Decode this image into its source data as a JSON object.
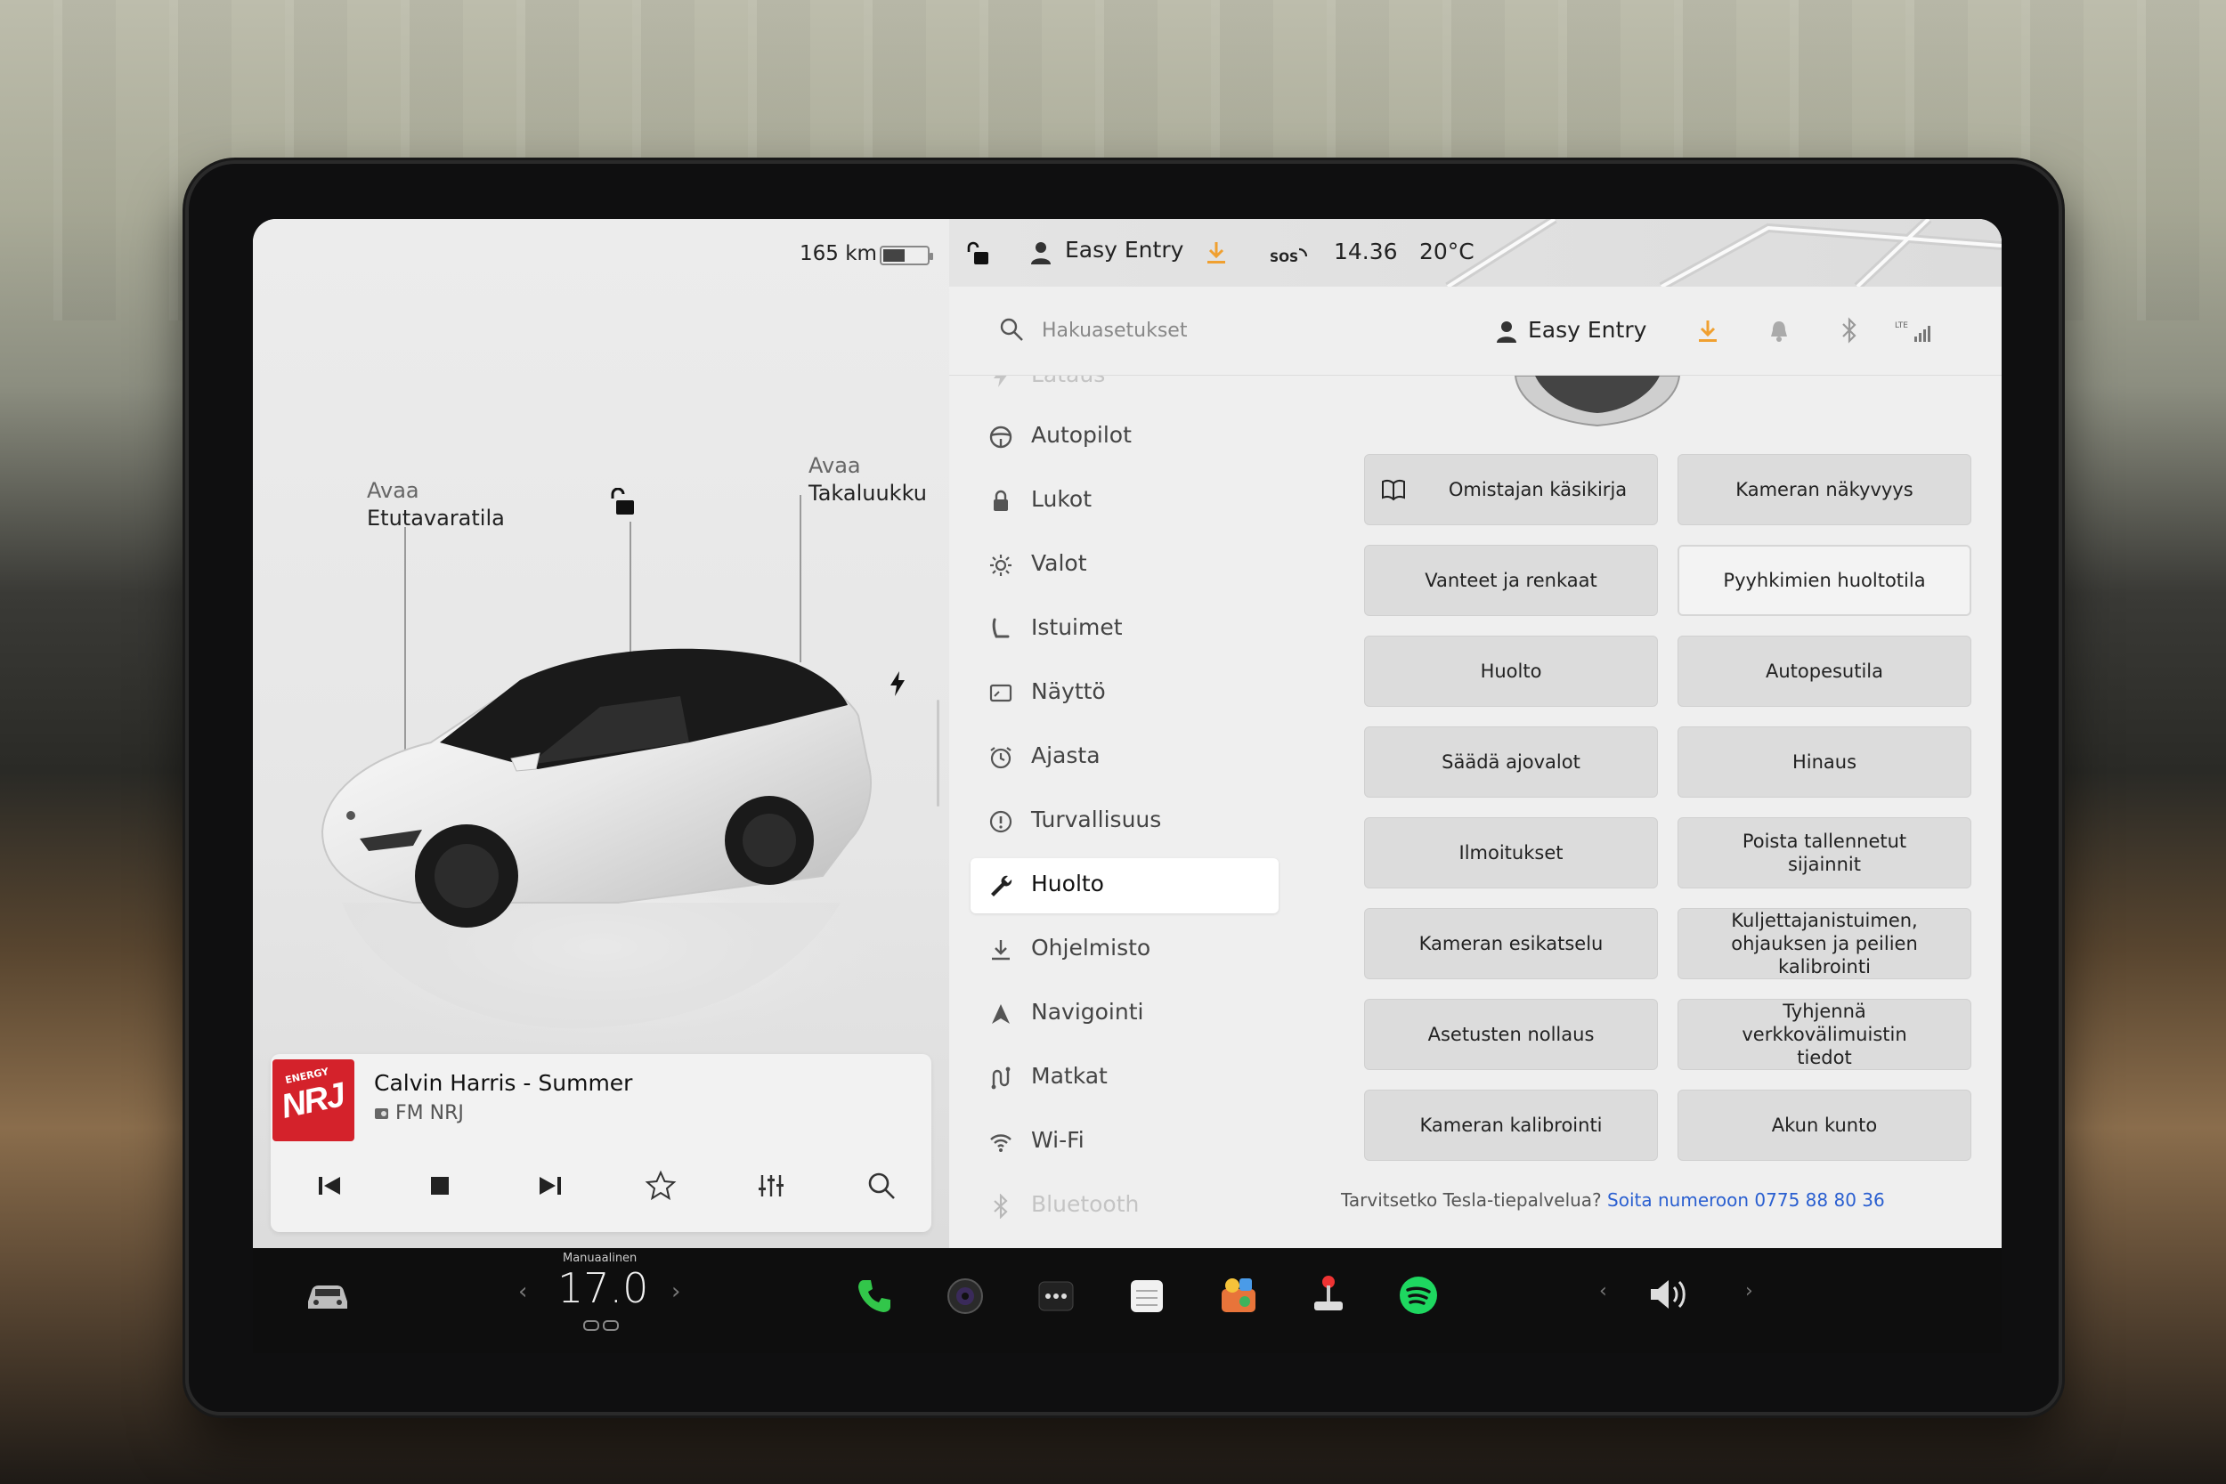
{
  "vehicle": {
    "range": "165 km",
    "battery_level": 0.5,
    "frunk_label_line1": "Avaa",
    "frunk_label_line2": "Etutavaratila",
    "trunk_label_line1": "Avaa",
    "trunk_label_line2": "Takaluukku"
  },
  "media": {
    "song": "Calvin Harris - Summer",
    "station": "FM NRJ",
    "logo_text": "NRJ",
    "logo_subtext": "ENERGY"
  },
  "status_bar": {
    "profile": "Easy Entry",
    "time": "14.36",
    "temperature": "20°C",
    "sos": "SOS"
  },
  "settings_header": {
    "search_placeholder": "Hakuasetukset",
    "profile": "Easy Entry",
    "lte": "LTE"
  },
  "nav": {
    "items": [
      {
        "label": "Lataus"
      },
      {
        "label": "Autopilot"
      },
      {
        "label": "Lukot"
      },
      {
        "label": "Valot"
      },
      {
        "label": "Istuimet"
      },
      {
        "label": "Näyttö"
      },
      {
        "label": "Ajasta"
      },
      {
        "label": "Turvallisuus"
      },
      {
        "label": "Huolto"
      },
      {
        "label": "Ohjelmisto"
      },
      {
        "label": "Navigointi"
      },
      {
        "label": "Matkat"
      },
      {
        "label": "Wi-Fi"
      },
      {
        "label": "Bluetooth"
      }
    ],
    "active": "Huolto"
  },
  "service": {
    "tiles": [
      {
        "label": "Omistajan käsikirja"
      },
      {
        "label": "Kameran näkyvyys"
      },
      {
        "label": "Vanteet ja renkaat"
      },
      {
        "label": "Pyyhkimien huoltotila"
      },
      {
        "label": "Huolto"
      },
      {
        "label": "Autopesutila"
      },
      {
        "label": "Säädä ajovalot"
      },
      {
        "label": "Hinaus"
      },
      {
        "label": "Ilmoitukset"
      },
      {
        "label": "Poista tallennetut sijainnit"
      },
      {
        "label": "Kameran esikatselu"
      },
      {
        "label": "Kuljettajanistuimen, ohjauksen ja peilien kalibrointi"
      },
      {
        "label": "Asetusten nollaus"
      },
      {
        "label": "Tyhjennä verkkovälimuistin tiedot"
      },
      {
        "label": "Kameran kalibrointi"
      },
      {
        "label": "Akun kunto"
      }
    ],
    "help_text": "Tarvitsetko Tesla-tiepalvelua?",
    "help_link": "Soita numeroon 0775 88 80 36"
  },
  "taskbar": {
    "climate_mode": "Manuaalinen",
    "climate_temp": "17.0"
  },
  "colors": {
    "accent_orange": "#f0a030",
    "link_blue": "#2a5fd0",
    "phone_green": "#32c64a",
    "spotify_green": "#1ed760"
  }
}
